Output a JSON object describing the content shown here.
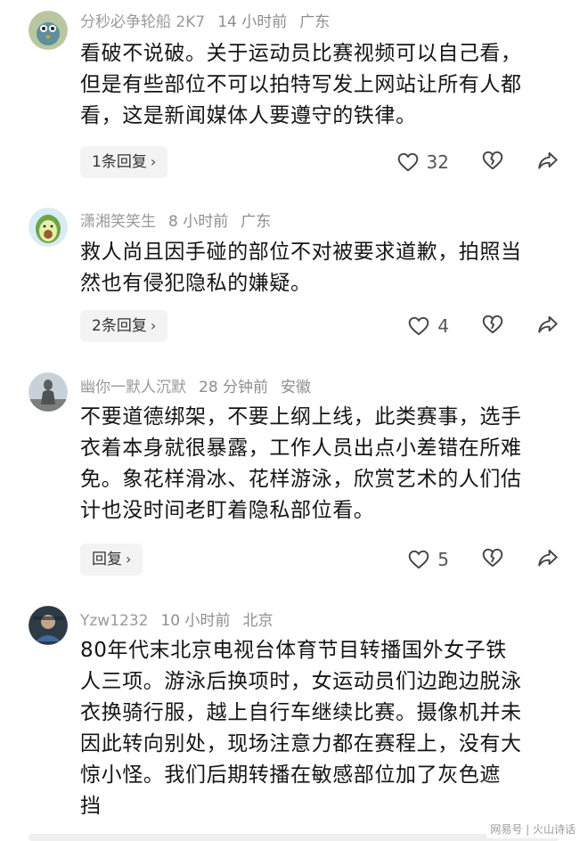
{
  "comments": [
    {
      "user": "分秒必争轮船 2K7",
      "time": "14 小时前",
      "location": "广东",
      "lines": [
        "看破不说破。关于运动员比赛视频可以自己看，",
        "但是有些部位不可以拍特写发上网站让所有人都",
        "看，这是新闻媒体人要遵守的铁律。"
      ],
      "reply_label": "1条回复",
      "likes": "32",
      "avatar_icon": "bird-cartoon-avatar"
    },
    {
      "user": "潇湘笑笑生",
      "time": "8 小时前",
      "location": "广东",
      "lines": [
        "救人尚且因手碰的部位不对被要求道歉，拍照当",
        "然也有侵犯隐私的嫌疑。"
      ],
      "reply_label": "2条回复",
      "likes": "4",
      "avatar_icon": "avocado-avatar"
    },
    {
      "user": "幽你一默人沉默",
      "time": "28 分钟前",
      "location": "安徽",
      "lines": [
        "不要道德绑架，不要上纲上线，此类赛事，选手",
        "衣着本身就很暴露，工作人员出点小差错在所难",
        "免。象花样滑冰、花样游泳，欣赏艺术的人们估",
        "计也没时间老盯着隐私部位看。"
      ],
      "reply_label": "回复",
      "likes": "5",
      "avatar_icon": "statue-avatar"
    },
    {
      "user": "Yzw1232",
      "time": "10 小时前",
      "location": "北京",
      "lines": [
        "80年代末北京电视台体育节目转播国外女子铁",
        "人三项。游泳后换项时，女运动员们边跑边脱泳",
        "衣换骑行服，越上自行车继续比赛。摄像机并未",
        "因此转向别处，现场注意力都在赛程上，没有大",
        "惊小怪。我们后期转播在敏感部位加了灰色遮",
        "挡"
      ],
      "reply_label": "",
      "likes": "",
      "avatar_icon": "person-photo-avatar"
    }
  ],
  "watermark": "网易号 | 火山诗话"
}
